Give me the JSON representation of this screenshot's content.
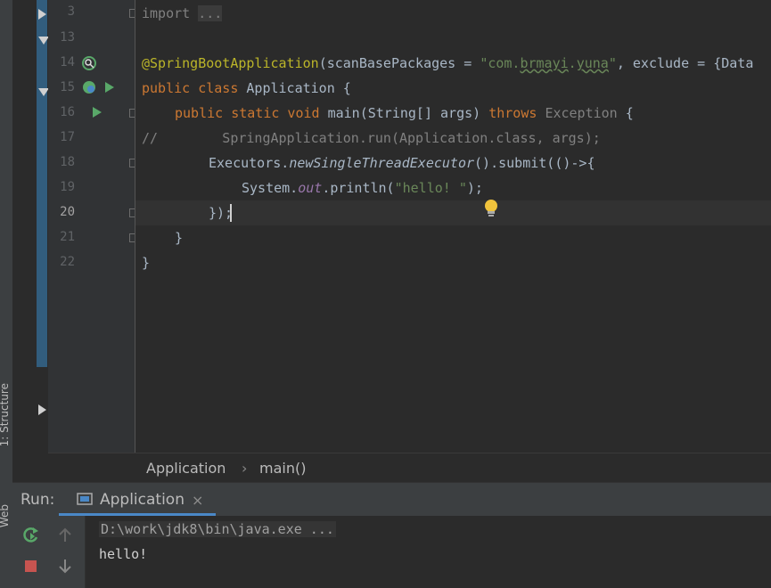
{
  "editor": {
    "lines": [
      {
        "number": "3"
      },
      {
        "number": "13"
      },
      {
        "number": "14"
      },
      {
        "number": "15"
      },
      {
        "number": "16"
      },
      {
        "number": "17"
      },
      {
        "number": "18"
      },
      {
        "number": "19"
      },
      {
        "number": "20"
      },
      {
        "number": "21"
      },
      {
        "number": "22"
      }
    ],
    "code": {
      "l3_import": "import",
      "l3_fold": "...",
      "l14_ann": "@SpringBootApplication",
      "l14_a": "(scanBasePackages = ",
      "l14_str1": "\"com.",
      "l14_str2": "brmayi",
      "l14_str3": ".",
      "l14_str4": "yuna",
      "l14_str5": "\"",
      "l14_b": ", exclude = {Data",
      "l15_kw": "public class ",
      "l15_name": "Application {",
      "l16_kw": "public static void ",
      "l16_a": "main(String[] args) ",
      "l16_throws": "throws ",
      "l16_exc": "Exception",
      "l16_b": " {",
      "l17": "//        SpringApplication.run(Application.class, args);",
      "l18_a": "Executors.",
      "l18_b": "newSingleThreadExecutor",
      "l18_c": "().submit(()->{",
      "l19_a": "System.",
      "l19_b": "out",
      "l19_c": ".println(",
      "l19_str": "\"hello! \"",
      "l19_d": ");",
      "l20": "});",
      "l21": "}",
      "l22": "}"
    }
  },
  "breadcrumb": {
    "class": "Application",
    "sep": "›",
    "method": "main()"
  },
  "run_panel": {
    "label": "Run:",
    "tab_label": "Application",
    "tab_close": "×",
    "output": [
      "D:\\work\\jdk8\\bin\\java.exe ...",
      "hello!"
    ]
  },
  "side_tabs": {
    "structure": "1: Structure",
    "web": "Web"
  },
  "colors": {
    "keyword": "#cc7832",
    "annotation": "#bbb529",
    "string": "#6a8759",
    "accent": "#4a88c7"
  }
}
